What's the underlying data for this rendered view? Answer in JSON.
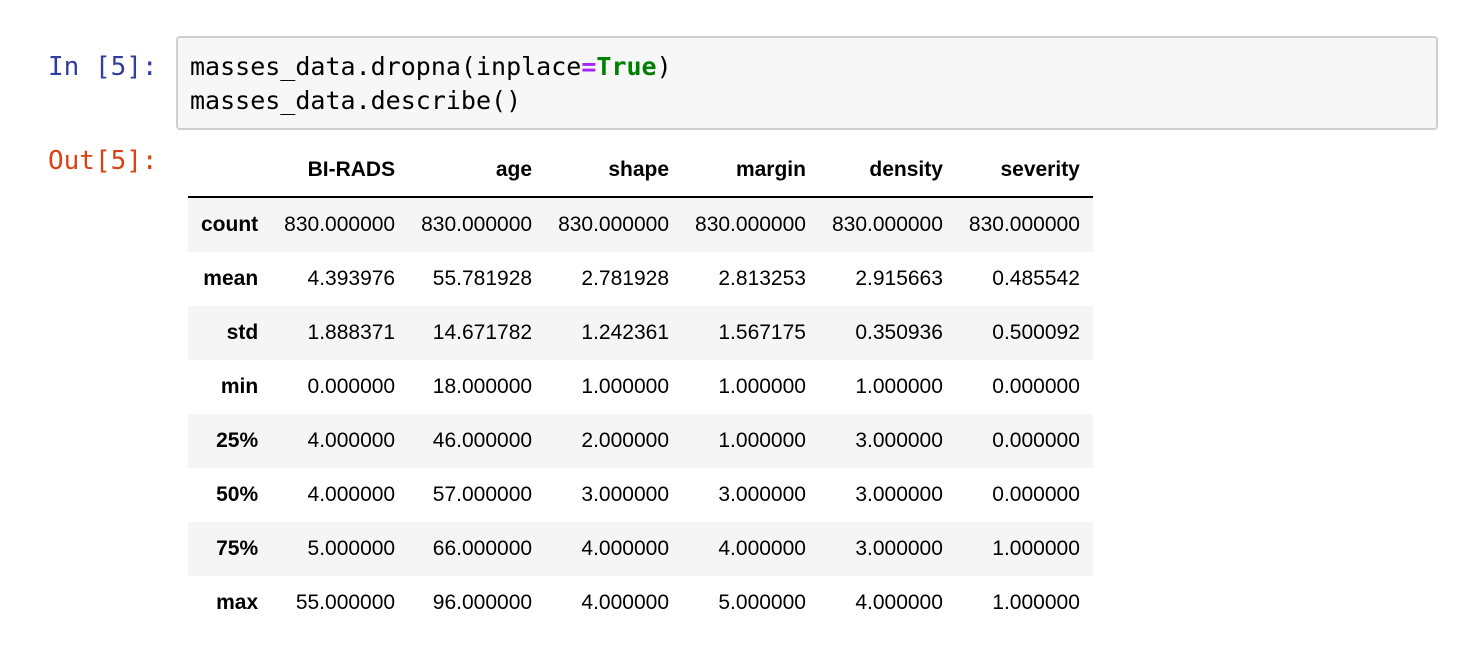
{
  "cell_in": {
    "prompt": "In [5]:",
    "code": {
      "line1_pre": "masses_data.dropna(inplace",
      "line1_op": "=",
      "line1_kw": "True",
      "line1_post": ")",
      "line2": "masses_data.describe()"
    }
  },
  "cell_out": {
    "prompt": "Out[5]:",
    "table": {
      "index_header": "",
      "columns": [
        "BI-RADS",
        "age",
        "shape",
        "margin",
        "density",
        "severity"
      ],
      "rows": [
        {
          "label": "count",
          "values": [
            "830.000000",
            "830.000000",
            "830.000000",
            "830.000000",
            "830.000000",
            "830.000000"
          ]
        },
        {
          "label": "mean",
          "values": [
            "4.393976",
            "55.781928",
            "2.781928",
            "2.813253",
            "2.915663",
            "0.485542"
          ]
        },
        {
          "label": "std",
          "values": [
            "1.888371",
            "14.671782",
            "1.242361",
            "1.567175",
            "0.350936",
            "0.500092"
          ]
        },
        {
          "label": "min",
          "values": [
            "0.000000",
            "18.000000",
            "1.000000",
            "1.000000",
            "1.000000",
            "0.000000"
          ]
        },
        {
          "label": "25%",
          "values": [
            "4.000000",
            "46.000000",
            "2.000000",
            "1.000000",
            "3.000000",
            "0.000000"
          ]
        },
        {
          "label": "50%",
          "values": [
            "4.000000",
            "57.000000",
            "3.000000",
            "3.000000",
            "3.000000",
            "0.000000"
          ]
        },
        {
          "label": "75%",
          "values": [
            "5.000000",
            "66.000000",
            "4.000000",
            "4.000000",
            "3.000000",
            "1.000000"
          ]
        },
        {
          "label": "max",
          "values": [
            "55.000000",
            "96.000000",
            "4.000000",
            "5.000000",
            "4.000000",
            "1.000000"
          ]
        }
      ]
    }
  },
  "colors": {
    "prompt_in": "#303f9f",
    "prompt_out": "#d84315",
    "operator": "#aa22ff",
    "keyword": "#008000",
    "cell_background": "#f7f7f7",
    "cell_border": "#cfcfcf",
    "row_stripe": "#f5f5f5"
  }
}
